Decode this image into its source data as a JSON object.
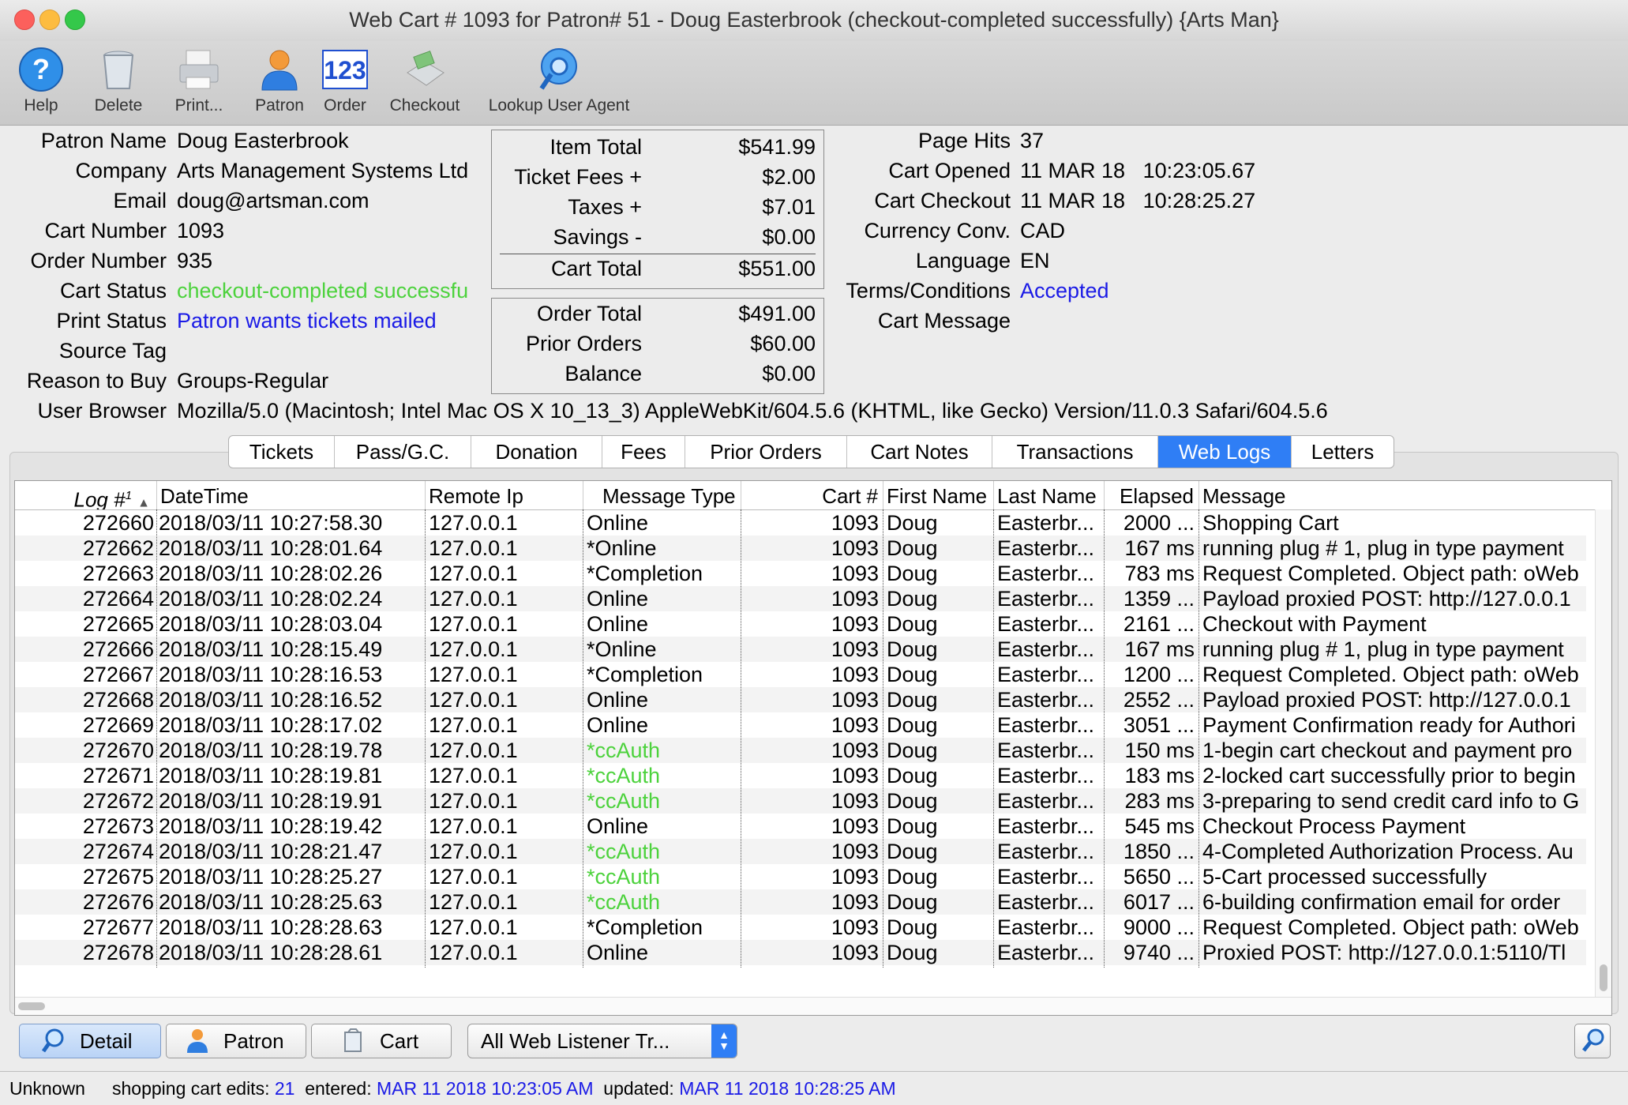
{
  "window": {
    "title": "Web Cart # 1093 for Patron# 51 - Doug Easterbrook (checkout-completed successfully) {Arts Man}"
  },
  "toolbar": [
    {
      "label": "Help",
      "icon": "help-icon"
    },
    {
      "label": "Delete",
      "icon": "trash-icon"
    },
    {
      "label": "Print...",
      "icon": "printer-icon"
    },
    {
      "label": "Patron",
      "icon": "person-icon"
    },
    {
      "label": "Order",
      "icon": "order-123-icon"
    },
    {
      "label": "Checkout",
      "icon": "cash-register-icon"
    },
    {
      "label": "Lookup User Agent",
      "icon": "globe-search-icon"
    }
  ],
  "patron": {
    "fields": [
      {
        "label": "Patron Name",
        "value": "Doug Easterbrook"
      },
      {
        "label": "Company",
        "value": "Arts Management Systems Ltd"
      },
      {
        "label": "Email",
        "value": "doug@artsman.com"
      },
      {
        "label": "Cart Number",
        "value": "1093"
      },
      {
        "label": "Order Number",
        "value": "935"
      },
      {
        "label": "Cart Status",
        "value": "checkout-completed successfully"
      },
      {
        "label": "Print Status",
        "value": "Patron wants tickets mailed"
      },
      {
        "label": "Source Tag",
        "value": ""
      },
      {
        "label": "Reason to Buy",
        "value": "Groups-Regular"
      }
    ],
    "browser_label": "User Browser",
    "browser_value": "Mozilla/5.0 (Macintosh; Intel Mac OS X 10_13_3) AppleWebKit/604.5.6 (KHTML, like Gecko) Version/11.0.3 Safari/604.5.6"
  },
  "totals": {
    "cart": [
      {
        "label": "Item Total",
        "value": "$541.99"
      },
      {
        "label": "Ticket Fees +",
        "value": "$2.00"
      },
      {
        "label": "Taxes +",
        "value": "$7.01"
      },
      {
        "label": "Savings -",
        "value": "$0.00"
      },
      {
        "label": "Cart Total",
        "value": "$551.00"
      }
    ],
    "order": [
      {
        "label": "Order Total",
        "value": "$491.00"
      },
      {
        "label": "Prior Orders",
        "value": "$60.00"
      },
      {
        "label": "Balance",
        "value": "$0.00"
      }
    ]
  },
  "session": [
    {
      "label": "Page Hits",
      "value": "37"
    },
    {
      "label": "Cart Opened",
      "value": "11 MAR 18   10:23:05.67"
    },
    {
      "label": "Cart Checkout",
      "value": "11 MAR 18   10:28:25.27"
    },
    {
      "label": "Currency Conv.",
      "value": "CAD"
    },
    {
      "label": "Language",
      "value": "EN"
    },
    {
      "label": "Terms/Conditions",
      "value": "Accepted"
    },
    {
      "label": "Cart Message",
      "value": ""
    }
  ],
  "tabs": [
    "Tickets",
    "Pass/G.C.",
    "Donation",
    "Fees",
    "Prior Orders",
    "Cart Notes",
    "Transactions",
    "Web Logs",
    "Letters"
  ],
  "active_tab": "Web Logs",
  "table": {
    "headers": [
      "Log #",
      "DateTime",
      "Remote Ip",
      "Message Type",
      "Cart #",
      "First Name",
      "Last Name",
      "Elapsed",
      "Message"
    ],
    "sort_marker": "1",
    "rows": [
      [
        "272660",
        "2018/03/11 10:27:58.30",
        "127.0.0.1",
        "Online",
        "1093",
        "Doug",
        "Easterbr...",
        "2000 ...",
        "Shopping Cart"
      ],
      [
        "272662",
        "2018/03/11 10:28:01.64",
        "127.0.0.1",
        "*Online",
        "1093",
        "Doug",
        "Easterbr...",
        "167 ms",
        "running plug # 1, plug in type payment"
      ],
      [
        "272663",
        "2018/03/11 10:28:02.26",
        "127.0.0.1",
        "*Completion",
        "1093",
        "Doug",
        "Easterbr...",
        "783 ms",
        "Request Completed.  Object path: oWeb"
      ],
      [
        "272664",
        "2018/03/11 10:28:02.24",
        "127.0.0.1",
        "Online",
        "1093",
        "Doug",
        "Easterbr...",
        "1359 ...",
        "Payload proxied POST: http://127.0.0.1"
      ],
      [
        "272665",
        "2018/03/11 10:28:03.04",
        "127.0.0.1",
        "Online",
        "1093",
        "Doug",
        "Easterbr...",
        "2161 ...",
        "Checkout with Payment"
      ],
      [
        "272666",
        "2018/03/11 10:28:15.49",
        "127.0.0.1",
        "*Online",
        "1093",
        "Doug",
        "Easterbr...",
        "167 ms",
        "running plug # 1, plug in type payment"
      ],
      [
        "272667",
        "2018/03/11 10:28:16.53",
        "127.0.0.1",
        "*Completion",
        "1093",
        "Doug",
        "Easterbr...",
        "1200 ...",
        "Request Completed.  Object path: oWeb"
      ],
      [
        "272668",
        "2018/03/11 10:28:16.52",
        "127.0.0.1",
        "Online",
        "1093",
        "Doug",
        "Easterbr...",
        "2552 ...",
        "Payload proxied POST: http://127.0.0.1"
      ],
      [
        "272669",
        "2018/03/11 10:28:17.02",
        "127.0.0.1",
        "Online",
        "1093",
        "Doug",
        "Easterbr...",
        "3051 ...",
        "Payment Confirmation ready for Authori"
      ],
      [
        "272670",
        "2018/03/11 10:28:19.78",
        "127.0.0.1",
        "*ccAuth",
        "1093",
        "Doug",
        "Easterbr...",
        "150 ms",
        "1-begin cart checkout and payment pro"
      ],
      [
        "272671",
        "2018/03/11 10:28:19.81",
        "127.0.0.1",
        "*ccAuth",
        "1093",
        "Doug",
        "Easterbr...",
        "183 ms",
        "2-locked cart successfully prior to begin"
      ],
      [
        "272672",
        "2018/03/11 10:28:19.91",
        "127.0.0.1",
        "*ccAuth",
        "1093",
        "Doug",
        "Easterbr...",
        "283 ms",
        "3-preparing to send credit card info to G"
      ],
      [
        "272673",
        "2018/03/11 10:28:19.42",
        "127.0.0.1",
        "Online",
        "1093",
        "Doug",
        "Easterbr...",
        "545 ms",
        "Checkout Process Payment"
      ],
      [
        "272674",
        "2018/03/11 10:28:21.47",
        "127.0.0.1",
        "*ccAuth",
        "1093",
        "Doug",
        "Easterbr...",
        "1850 ...",
        "4-Completed Authorization Process.  Au"
      ],
      [
        "272675",
        "2018/03/11 10:28:25.27",
        "127.0.0.1",
        "*ccAuth",
        "1093",
        "Doug",
        "Easterbr...",
        "5650 ...",
        "5-Cart processed successfully"
      ],
      [
        "272676",
        "2018/03/11 10:28:25.63",
        "127.0.0.1",
        "*ccAuth",
        "1093",
        "Doug",
        "Easterbr...",
        "6017 ...",
        "6-building confirmation email for order"
      ],
      [
        "272677",
        "2018/03/11 10:28:28.63",
        "127.0.0.1",
        "*Completion",
        "1093",
        "Doug",
        "Easterbr...",
        "9000 ...",
        "Request Completed.  Object path: oWeb"
      ],
      [
        "272678",
        "2018/03/11 10:28:28.61",
        "127.0.0.1",
        "Online",
        "1093",
        "Doug",
        "Easterbr...",
        "9740 ...",
        "Proxied POST: http://127.0.0.1:5110/Tl"
      ]
    ]
  },
  "bottom": {
    "detail": "Detail",
    "patron": "Patron",
    "cart": "Cart",
    "filter": "All Web Listener Tr..."
  },
  "status": {
    "mode": "Unknown",
    "edits_label": "shopping cart edits:",
    "edits_value": "21",
    "entered_label": "entered:",
    "entered_value": "MAR 11 2018 10:23:05 AM",
    "updated_label": "updated:",
    "updated_value": "MAR 11 2018 10:28:25 AM"
  },
  "colors": {
    "green": "#4cd23c",
    "blue": "#1a1ae6",
    "accent": "#2f7ef5"
  }
}
